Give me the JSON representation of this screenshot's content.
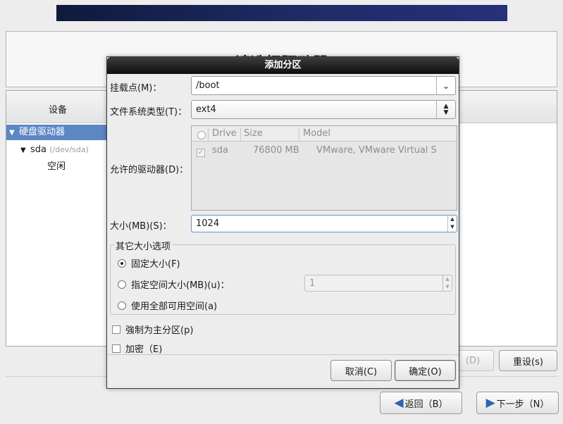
{
  "page": {
    "title": "请选择驱动器"
  },
  "tree": {
    "column_header": "设备",
    "items": [
      {
        "label": "硬盘驱动器"
      },
      {
        "label": "sda",
        "sublabel": "(/dev/sda)"
      },
      {
        "label": "空闲"
      }
    ]
  },
  "background_buttons": {
    "delete": "(D)",
    "reset": "重设(s)",
    "back": "返回（B）",
    "next": "下一步（N）"
  },
  "dialog": {
    "title": "添加分区",
    "mount_point": {
      "label": "挂载点(M)：",
      "value": "/boot"
    },
    "fs_type": {
      "label": "文件系统类型(T)：",
      "value": "ext4"
    },
    "drives": {
      "label": "允许的驱动器(D)：",
      "columns": [
        "Drive",
        "Size",
        "Model"
      ],
      "rows": [
        {
          "drive": "sda",
          "size": "76800 MB",
          "model": "VMware, VMware Virtual S",
          "checked": true
        }
      ]
    },
    "size": {
      "label": "大小(MB)(S)：",
      "value": "1024"
    },
    "other_options": {
      "title": "其它大小选项",
      "fixed": "固定大小(F)",
      "fill_to": "指定空间大小(MB)(u)：",
      "fill_to_value": "1",
      "fill_all": "使用全部可用空间(a)",
      "selected": "fixed"
    },
    "force_primary": {
      "label": "強制为主分区(p)",
      "checked": false
    },
    "encrypt": {
      "label": "加密（E)",
      "checked": false
    },
    "cancel": "取消(C)",
    "ok": "确定(O)"
  },
  "colors": {
    "selection": "#5d87c4",
    "dialog_titlebar": "#1a1a1a",
    "banner": "#1f2b66"
  }
}
